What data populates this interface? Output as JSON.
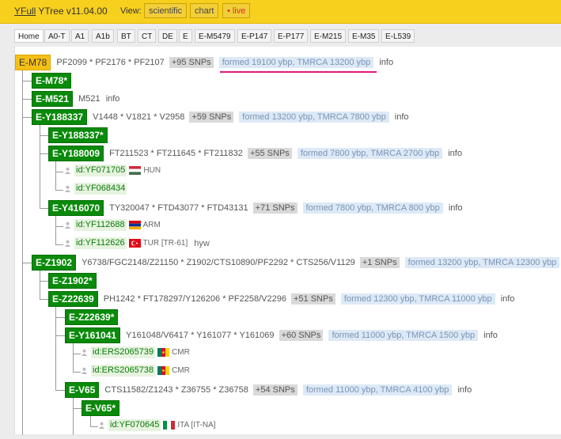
{
  "header": {
    "brand_link": "YFull",
    "brand_rest": "YTree v11.04.00",
    "view_label": "View:",
    "view_buttons": [
      "scientific",
      "chart",
      "• live"
    ]
  },
  "tabs": [
    "Home",
    "A0-T",
    "A1",
    "A1b",
    "BT",
    "CT",
    "DE",
    "E",
    "E-M5479",
    "E-P147",
    "E-P177",
    "E-M215",
    "E-M35",
    "E-L539"
  ],
  "tree": {
    "root": {
      "name": "E-M78",
      "snps": "PF2099 * PF2176 * PF2107",
      "more": "+95 SNPs",
      "formed": "formed 19100 ybp, TMRCA 13200 ybp",
      "info": "info"
    },
    "m78star": {
      "name": "E-M78*"
    },
    "m521": {
      "name": "E-M521",
      "snps": "M521",
      "info": "info"
    },
    "y188337": {
      "name": "E-Y188337",
      "snps": "V1448 * V1821 * V2958",
      "more": "+59 SNPs",
      "formed": "formed 13200 ybp, TMRCA 7800 ybp",
      "info": "info"
    },
    "y188337star": {
      "name": "E-Y188337*"
    },
    "y188009": {
      "name": "E-Y188009",
      "snps": "FT211523 * FT211645 * FT211832",
      "more": "+55 SNPs",
      "formed": "formed 7800 ybp, TMRCA 2700 ybp",
      "info": "info"
    },
    "s1": {
      "id": "id:YF071705",
      "country": "HUN"
    },
    "s2": {
      "id": "id:YF068434"
    },
    "y416070": {
      "name": "E-Y416070",
      "snps": "TY320047 * FTD43077 * FTD43131",
      "more": "+71 SNPs",
      "formed": "formed 7800 ybp, TMRCA 800 ybp",
      "info": "info"
    },
    "s3": {
      "id": "id:YF112688",
      "country": "ARM"
    },
    "s4": {
      "id": "id:YF112626",
      "country": "TUR [TR-61]",
      "comment": "hyw"
    },
    "z1902": {
      "name": "E-Z1902",
      "snps": "Y6738/FGC2148/Z21150 * Z1902/CTS10890/PF2292 * CTS256/V1129",
      "more": "+1 SNPs",
      "formed": "formed 13200 ybp, TMRCA 12300 ybp"
    },
    "z1902star": {
      "name": "E-Z1902*"
    },
    "z22639": {
      "name": "E-Z22639",
      "snps": "PH1242 * FT178297/Y126206 * PF2258/V2296",
      "more": "+51 SNPs",
      "formed": "formed 12300 ybp, TMRCA 11000 ybp",
      "info": "info"
    },
    "z22639star": {
      "name": "E-Z22639*"
    },
    "y161041": {
      "name": "E-Y161041",
      "snps": "Y161048/V6417 * Y161077 * Y161069",
      "more": "+60 SNPs",
      "formed": "formed 11000 ybp, TMRCA 1500 ybp",
      "info": "info"
    },
    "s5": {
      "id": "id:ERS2065739",
      "country": "CMR"
    },
    "s6": {
      "id": "id:ERS2065738",
      "country": "CMR"
    },
    "v65": {
      "name": "E-V65",
      "snps": "CTS11582/Z1243 * Z36755 * Z36758",
      "more": "+54 SNPs",
      "formed": "formed 11000 ybp, TMRCA 4100 ybp",
      "info": "info"
    },
    "v65star": {
      "name": "E-V65*"
    },
    "s7": {
      "id": "id:YF070645",
      "country": "ITA [IT-NA]"
    }
  },
  "colors": {
    "header": "#f7d01e",
    "node": "#0a8a0a",
    "root_node": "#f5c015",
    "formed_bg": "#dde9f6",
    "highlight": "#e0197d"
  }
}
